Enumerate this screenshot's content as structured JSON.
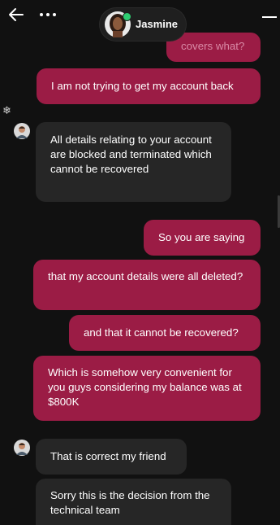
{
  "header": {
    "back_icon": "arrow-left-icon",
    "more_icon": "more-horizontal-icon",
    "contact_name": "Jasmine",
    "contact_status_color": "#2ecc71",
    "minimize_icon": "minimize-icon"
  },
  "colors": {
    "sent_bubble": "#9b1c45",
    "received_bubble": "#262626",
    "background": "#111111"
  },
  "messages": [
    {
      "id": "m0",
      "from": "user",
      "text": "covers what?"
    },
    {
      "id": "m1",
      "from": "user",
      "text": "I am not trying to get my account back"
    },
    {
      "id": "m2",
      "from": "agent",
      "text": "All details relating to your account are blocked and terminated which cannot be recovered"
    },
    {
      "id": "m3",
      "from": "user",
      "text": "So you are saying"
    },
    {
      "id": "m4",
      "from": "user",
      "text": "that my account details were all deleted?"
    },
    {
      "id": "m5",
      "from": "user",
      "text": "and that it cannot be recovered?"
    },
    {
      "id": "m6",
      "from": "user",
      "text": "Which is somehow very convenient for you guys considering my balance was at $800K"
    },
    {
      "id": "m7",
      "from": "agent",
      "text": "That is correct my friend"
    },
    {
      "id": "m8",
      "from": "agent",
      "text": "Sorry this is the decision from the technical team"
    }
  ]
}
